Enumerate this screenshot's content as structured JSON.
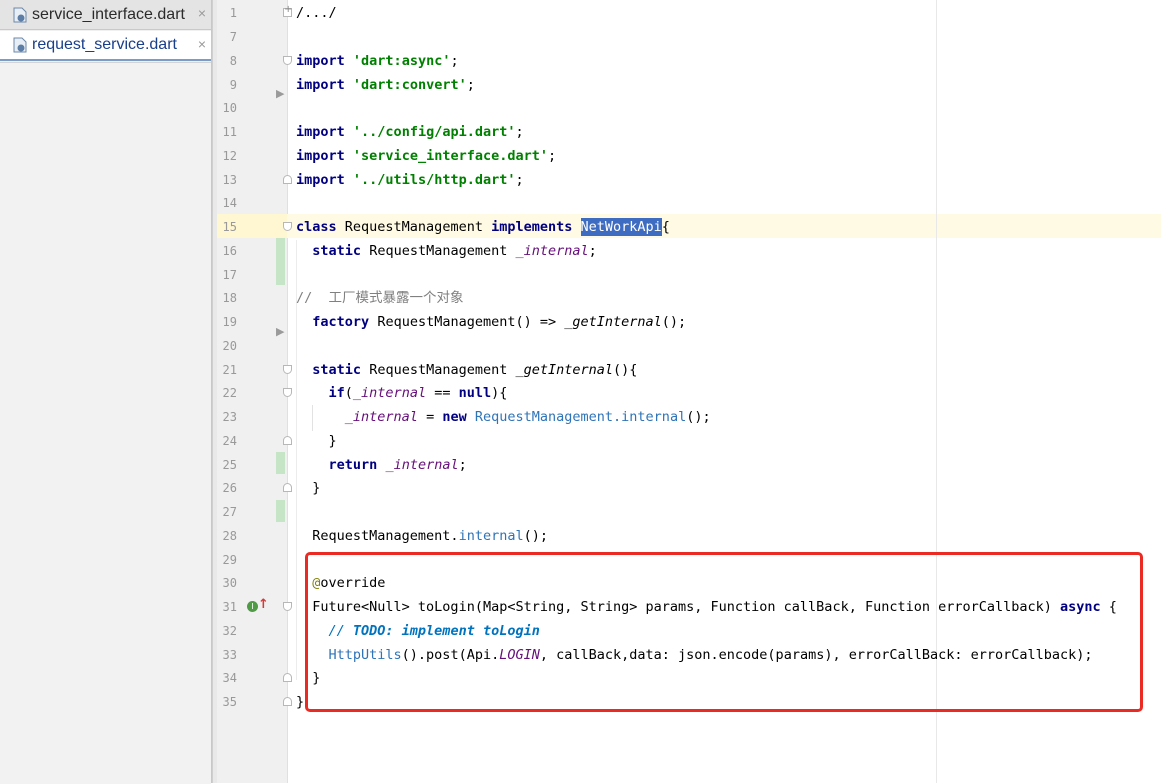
{
  "tabs": [
    {
      "label": "service_interface.dart",
      "close": "×",
      "icon": "dart-file-icon"
    },
    {
      "label": "request_service.dart",
      "close": "×",
      "icon": "dart-file-icon"
    }
  ],
  "lines": {
    "l1": {
      "num": "1",
      "t": "/.../"
    },
    "l7": {
      "num": "7"
    },
    "l8": {
      "num": "8",
      "kw": "import",
      "str": "'dart:async'",
      "end": ";"
    },
    "l9": {
      "num": "9",
      "kw": "import",
      "str": "'dart:convert'",
      "end": ";"
    },
    "l10": {
      "num": "10"
    },
    "l11": {
      "num": "11",
      "kw": "import",
      "str": "'../config/api.dart'",
      "end": ";"
    },
    "l12": {
      "num": "12",
      "kw": "import",
      "str": "'service_interface.dart'",
      "end": ";"
    },
    "l13": {
      "num": "13",
      "kw": "import",
      "str": "'../utils/http.dart'",
      "end": ";"
    },
    "l14": {
      "num": "14"
    },
    "l15": {
      "num": "15",
      "kw1": "class",
      "name": "RequestManagement",
      "kw2": "implements",
      "hl": "NetWorkApi",
      "end": "{"
    },
    "l16": {
      "num": "16",
      "kw": "static",
      "type": "RequestManagement",
      "field": "_internal",
      "end": ";"
    },
    "l17": {
      "num": "17"
    },
    "l18": {
      "num": "18",
      "comment": "//  工厂模式暴露一个对象"
    },
    "l19": {
      "num": "19",
      "kw": "factory",
      "a": "RequestManagement() => ",
      "call": "_getInternal",
      "end": "();"
    },
    "l20": {
      "num": "20"
    },
    "l21": {
      "num": "21",
      "kw": "static",
      "a": "RequestManagement ",
      "m": "_getInternal",
      "end": "(){"
    },
    "l22": {
      "num": "22",
      "kw": "if",
      "a": "(",
      "field": "_internal",
      "b": " == ",
      "kw2": "null",
      "end": "){"
    },
    "l23": {
      "num": "23",
      "field": "_internal",
      "a": " = ",
      "kw": "new",
      "cls": "RequestManagement",
      "dot": ".",
      "fld": "internal",
      "end": "();"
    },
    "l24": {
      "num": "24",
      "t": "}"
    },
    "l25": {
      "num": "25",
      "kw": "return",
      "field": "_internal",
      "end": ";"
    },
    "l26": {
      "num": "26",
      "t": "}"
    },
    "l27": {
      "num": "27"
    },
    "l28": {
      "num": "28",
      "a": "RequestManagement.",
      "fld": "internal",
      "end": "();"
    },
    "l29": {
      "num": "29"
    },
    "l30": {
      "num": "30",
      "at": "@",
      "t": "override"
    },
    "l31": {
      "num": "31",
      "a": "Future<Null> toLogin(Map<String, String> params, Function callBack, Function errorCallback) ",
      "kw": "async",
      "end": " {"
    },
    "l32": {
      "num": "32",
      "c": "// ",
      "todo": "TODO: implement toLogin"
    },
    "l33": {
      "num": "33",
      "cls": "HttpUtils",
      "a": "().post(Api.",
      "const": "LOGIN",
      "b": ", callBack,data: json.encode(params), errorCallBack: errorCallback);"
    },
    "l34": {
      "num": "34",
      "t": "}"
    },
    "l35": {
      "num": "35",
      "t": "}"
    }
  },
  "gutter_icons": {
    "implements_marker": "I",
    "override_arrow": "↑"
  }
}
